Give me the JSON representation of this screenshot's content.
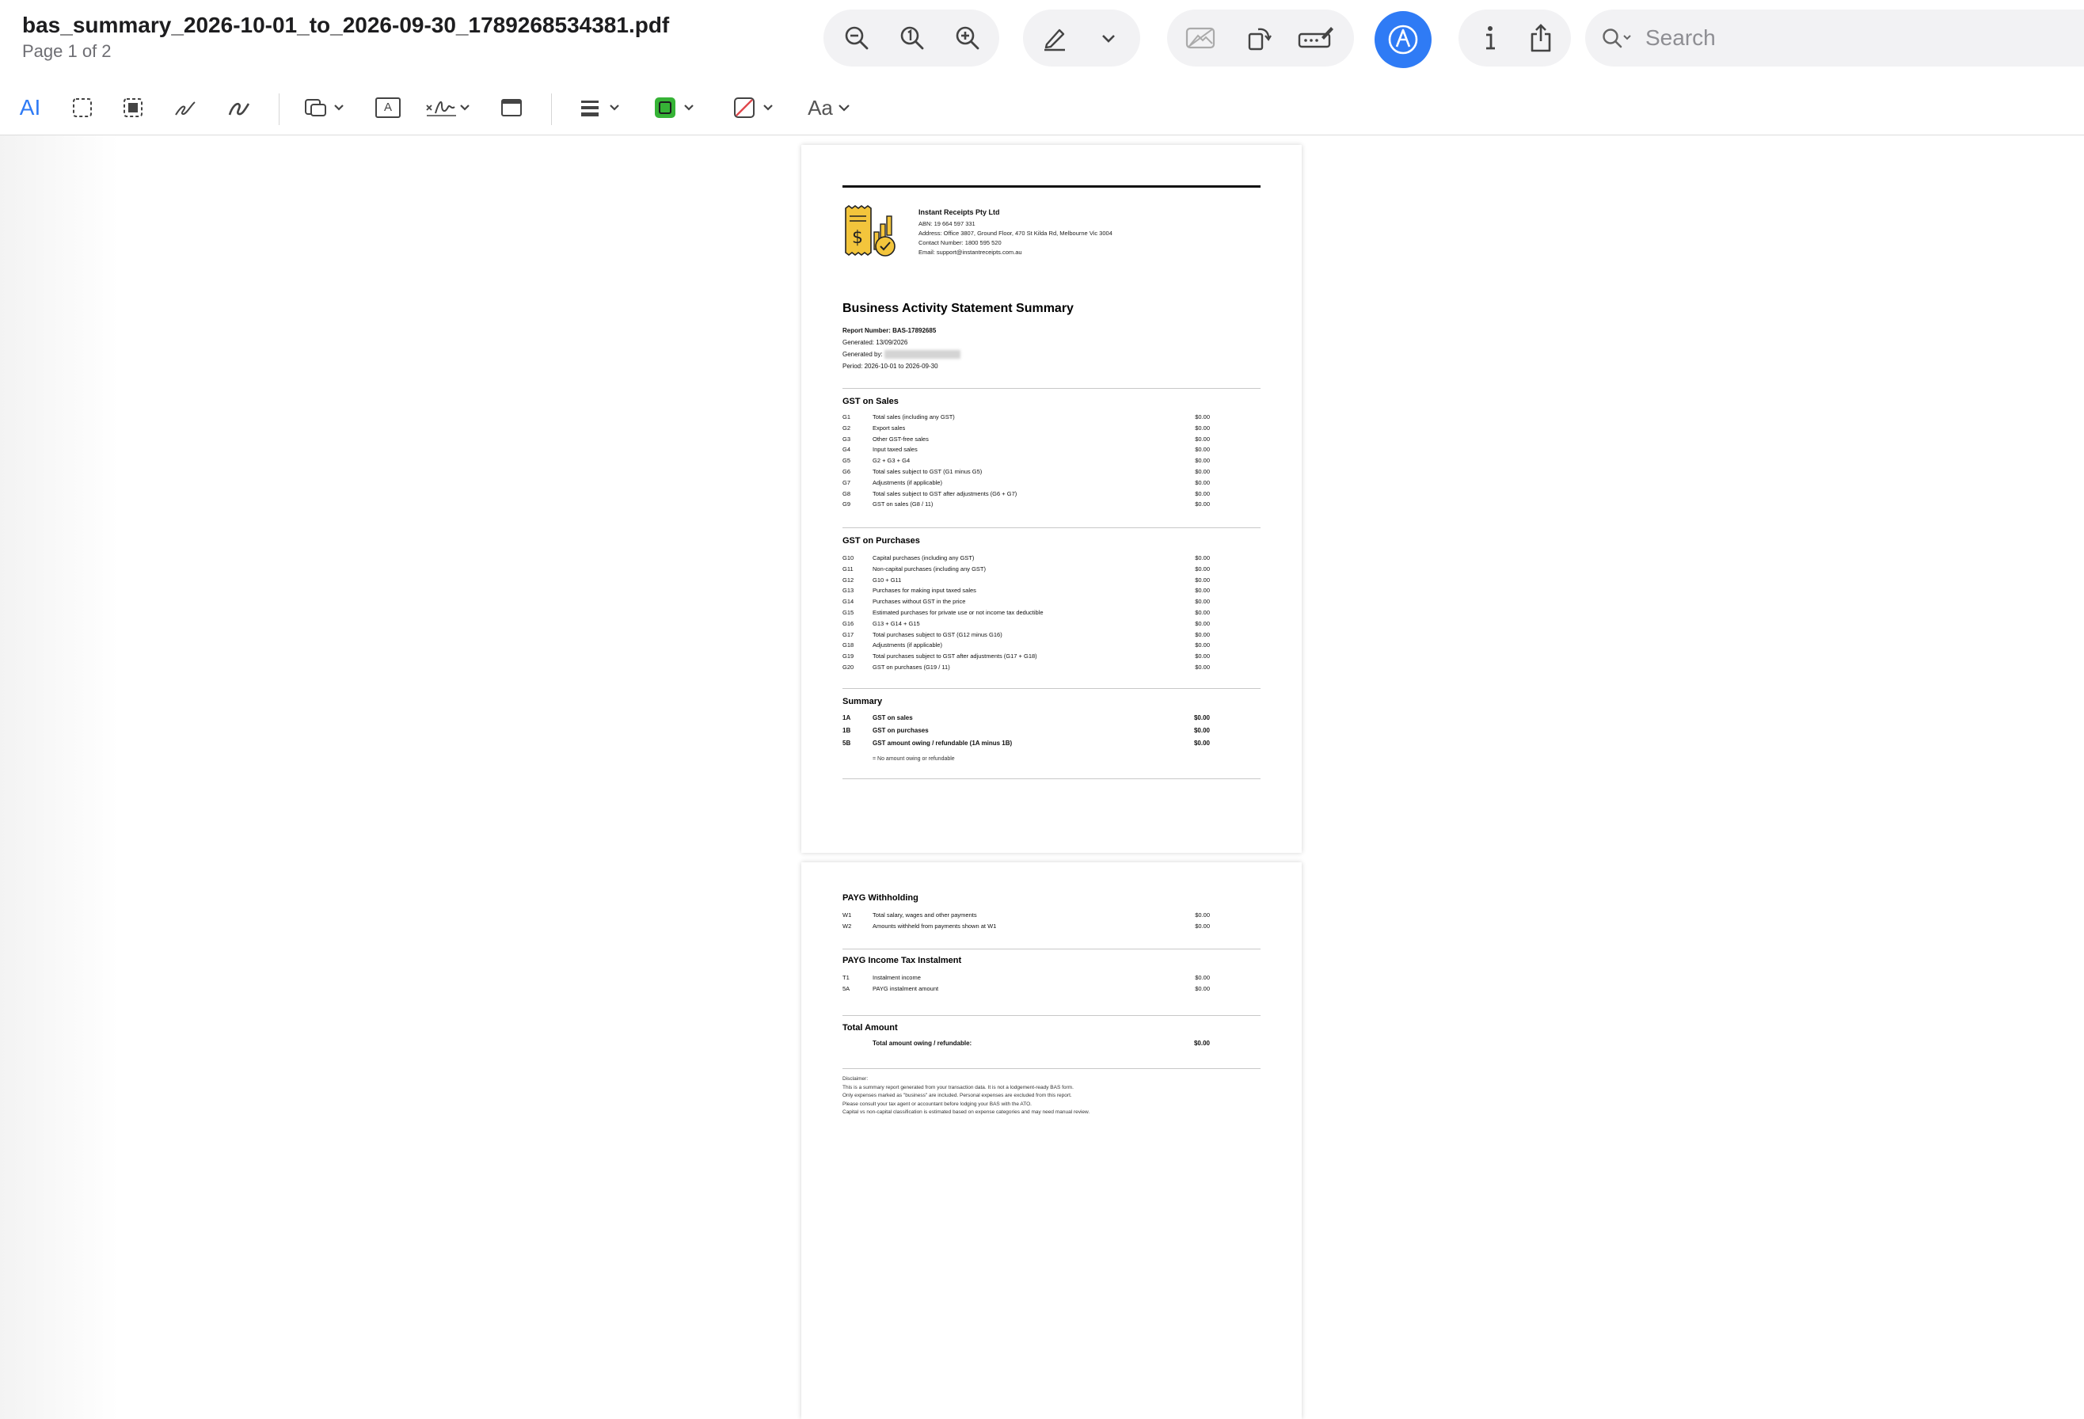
{
  "window": {
    "file_name": "bas_summary_2026-10-01_to_2026-09-30_1789268534381.pdf",
    "page_indicator": "Page 1 of 2",
    "search_placeholder": "Search"
  },
  "toolbar_icons": [
    "zoom-out-icon",
    "actual-size-icon",
    "zoom-in-icon",
    "highlight-pen-icon",
    "chevron-down-icon",
    "redact-icon",
    "rotate-icon",
    "sign-field-icon",
    "markup-icon",
    "info-icon",
    "share-icon",
    "search-icon"
  ],
  "markup_toolbar": {
    "icons": [
      "text-selection-icon",
      "rectangular-selection-icon",
      "smart-lasso-icon",
      "sketch-icon",
      "draw-icon",
      "shapes-icon",
      "text-box-icon",
      "signature-icon",
      "note-icon",
      "shape-style-icon",
      "border-color-icon",
      "fill-color-icon",
      "text-style-icon"
    ],
    "text_style_label": "Aa",
    "text_select_label": "A",
    "text_box_label": "A",
    "accent_color": "#2f7bf5",
    "border_color": "#36b336",
    "fill_color": "#e0474c"
  },
  "pdf": {
    "company": {
      "name": "Instant Receipts Pty Ltd",
      "abn": "ABN: 19 664 597 331",
      "address": "Address: Office 3807, Ground Floor, 470 St Kilda Rd, Melbourne Vic 3004",
      "contact": "Contact Number: 1800 595 520",
      "email": "Email: support@instantreceipts.com.au"
    },
    "title": "Business Activity Statement Summary",
    "report_number": "Report Number: BAS-17892685",
    "generated": "Generated: 13/09/2026",
    "generated_by_label": "Generated by:",
    "period": "Period: 2026-10-01 to 2026-09-30",
    "gst_sales": {
      "heading": "GST on Sales",
      "rows": [
        {
          "code": "G1",
          "label": "Total sales (including any GST)",
          "amount": "$0.00"
        },
        {
          "code": "G2",
          "label": "Export sales",
          "amount": "$0.00"
        },
        {
          "code": "G3",
          "label": "Other GST-free sales",
          "amount": "$0.00"
        },
        {
          "code": "G4",
          "label": "Input taxed sales",
          "amount": "$0.00"
        },
        {
          "code": "G5",
          "label": "G2 + G3 + G4",
          "amount": "$0.00"
        },
        {
          "code": "G6",
          "label": "Total sales subject to GST (G1 minus G5)",
          "amount": "$0.00"
        },
        {
          "code": "G7",
          "label": "Adjustments (if applicable)",
          "amount": "$0.00"
        },
        {
          "code": "G8",
          "label": "Total sales subject to GST after adjustments (G6 + G7)",
          "amount": "$0.00"
        },
        {
          "code": "G9",
          "label": "GST on sales (G8 / 11)",
          "amount": "$0.00"
        }
      ]
    },
    "gst_purchases": {
      "heading": "GST on Purchases",
      "rows": [
        {
          "code": "G10",
          "label": "Capital purchases (including any GST)",
          "amount": "$0.00"
        },
        {
          "code": "G11",
          "label": "Non-capital purchases (including any GST)",
          "amount": "$0.00"
        },
        {
          "code": "G12",
          "label": "G10 + G11",
          "amount": "$0.00"
        },
        {
          "code": "G13",
          "label": "Purchases for making input taxed sales",
          "amount": "$0.00"
        },
        {
          "code": "G14",
          "label": "Purchases without GST in the price",
          "amount": "$0.00"
        },
        {
          "code": "G15",
          "label": "Estimated purchases for private use or not income tax deductible",
          "amount": "$0.00"
        },
        {
          "code": "G16",
          "label": "G13 + G14 + G15",
          "amount": "$0.00"
        },
        {
          "code": "G17",
          "label": "Total purchases subject to GST (G12 minus G16)",
          "amount": "$0.00"
        },
        {
          "code": "G18",
          "label": "Adjustments (if applicable)",
          "amount": "$0.00"
        },
        {
          "code": "G19",
          "label": "Total purchases subject to GST after adjustments (G17 + G18)",
          "amount": "$0.00"
        },
        {
          "code": "G20",
          "label": "GST on purchases (G19 / 11)",
          "amount": "$0.00"
        }
      ]
    },
    "summary": {
      "heading": "Summary",
      "rows": [
        {
          "code": "1A",
          "label": "GST on sales",
          "amount": "$0.00"
        },
        {
          "code": "1B",
          "label": "GST on purchases",
          "amount": "$0.00"
        },
        {
          "code": "5B",
          "label": "GST amount owing / refundable (1A minus 1B)",
          "amount": "$0.00"
        }
      ],
      "note": "= No amount owing or refundable"
    },
    "payg_withholding": {
      "heading": "PAYG Withholding",
      "rows": [
        {
          "code": "W1",
          "label": "Total salary, wages and other payments",
          "amount": "$0.00"
        },
        {
          "code": "W2",
          "label": "Amounts withheld from payments shown at W1",
          "amount": "$0.00"
        }
      ]
    },
    "payg_instalment": {
      "heading": "PAYG Income Tax Instalment",
      "rows": [
        {
          "code": "T1",
          "label": "Instalment income",
          "amount": "$0.00"
        },
        {
          "code": "5A",
          "label": "PAYG instalment amount",
          "amount": "$0.00"
        }
      ]
    },
    "total": {
      "heading": "Total Amount",
      "label": "Total amount owing / refundable:",
      "amount": "$0.00"
    },
    "disclaimer": {
      "heading": "Disclaimer:",
      "lines": [
        "This is a summary report generated from your transaction data. It is not a lodgement-ready BAS form.",
        "Only expenses marked as \"business\" are included. Personal expenses are excluded from this report.",
        "Please consult your tax agent or accountant before lodging your BAS with the ATO.",
        "Capital vs non-capital classification is estimated based on expense categories and may need manual review."
      ]
    }
  }
}
